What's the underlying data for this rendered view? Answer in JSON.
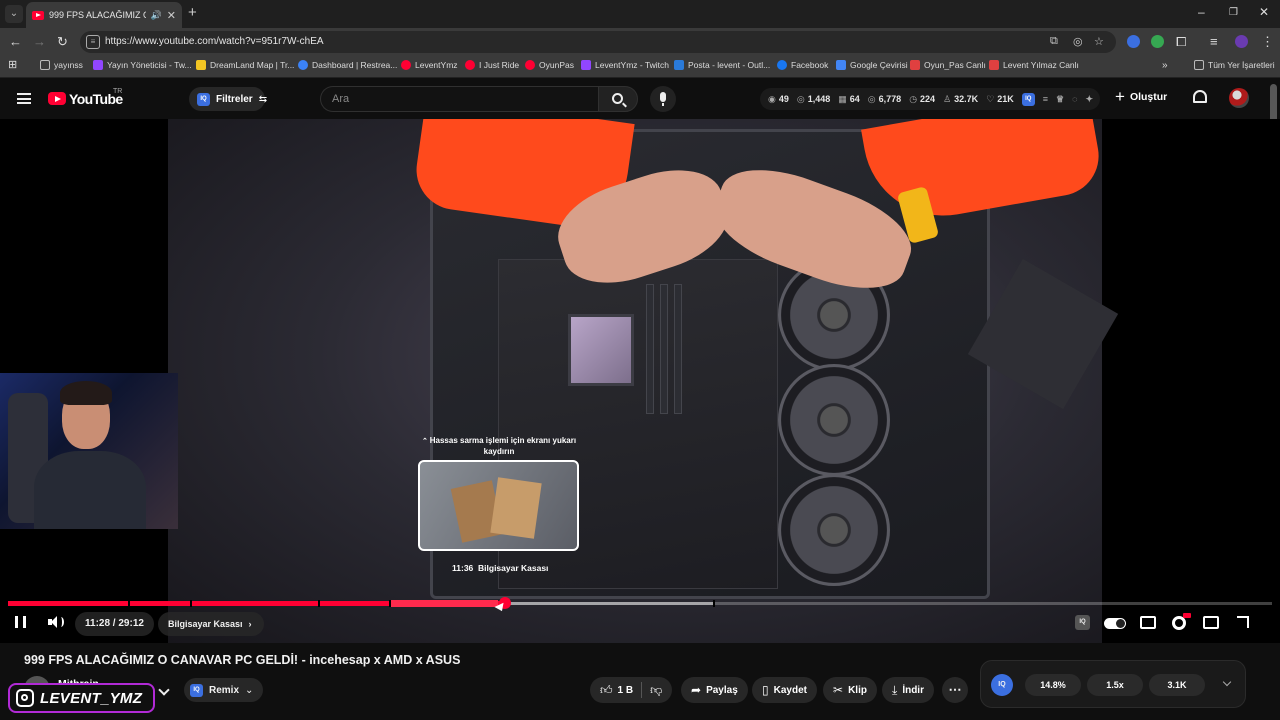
{
  "browser": {
    "tab_title": "999 FPS ALACAĞIMIZ O CANAVAR PC GELDİ! - incehesap x AMD x ASUS",
    "url": "https://www.youtube.com/watch?v=951r7W-chEA",
    "bookmarks": [
      {
        "label": "yayınss",
        "icon": "folder-icon",
        "color": "#bbbbbb"
      },
      {
        "label": "Yayın Yöneticisi - Tw...",
        "icon": "twitch-icon",
        "color": "#9146ff"
      },
      {
        "label": "DreamLand Map | Tr...",
        "icon": "dreamland-icon",
        "color": "#f3c623"
      },
      {
        "label": "Dashboard | Restrea...",
        "icon": "restream-icon",
        "color": "#3b82f6"
      },
      {
        "label": "LeventYmz",
        "icon": "youtube-icon",
        "color": "#ff0033"
      },
      {
        "label": "I Just Ride",
        "icon": "youtube-icon",
        "color": "#ff0033"
      },
      {
        "label": "OyunPas",
        "icon": "youtube-icon",
        "color": "#ff0033"
      },
      {
        "label": "LeventYmz - Twitch",
        "icon": "twitch-icon",
        "color": "#9146ff"
      },
      {
        "label": "Posta - levent - Outl...",
        "icon": "outlook-icon",
        "color": "#2a7ad9"
      },
      {
        "label": "Facebook",
        "icon": "facebook-icon",
        "color": "#1877f2"
      },
      {
        "label": "Google Çevirisi",
        "icon": "translate-icon",
        "color": "#4285f4"
      },
      {
        "label": "Oyun_Pas Canlı",
        "icon": "streamlabs-icon",
        "color": "#e04040"
      },
      {
        "label": "Levent Yılmaz Canlı",
        "icon": "streamlabs-icon",
        "color": "#e04040"
      }
    ],
    "all_bookmarks": "Tüm Yer İşaretleri"
  },
  "youtube": {
    "logo_text": "YouTube",
    "region": "TR",
    "filter_label": "Filtreler",
    "iq_label": "IQ",
    "search_placeholder": "Ara",
    "stats": [
      "49",
      "1,448",
      "64",
      "6,778",
      "224",
      "32.7K",
      "21K"
    ],
    "create_label": "Oluştur"
  },
  "player": {
    "hover_hint": "Hassas sarma işlemi için ekranı yukarı kaydırın",
    "preview_time": "11:36",
    "preview_chapter": "Bilgisayar Kasası",
    "time_display": "11:28 / 29:12",
    "current_chapter": "Bilgisayar Kasası",
    "progress_fraction": 0.393
  },
  "video": {
    "title": "999 FPS ALACAĞIMIZ O CANAVAR PC GELDİ! - incehesap x AMD x ASUS",
    "channel": "Mithrain",
    "remix_label": "Remix",
    "like_count": "1 B",
    "share_label": "Paylaş",
    "save_label": "Kaydet",
    "clip_label": "Klip",
    "download_label": "İndir"
  },
  "watermark": {
    "handle": "LEVENT_YMZ"
  },
  "iq_panel": {
    "label": "IQ",
    "values": [
      "14.8%",
      "1.5x",
      "3.1K"
    ]
  }
}
